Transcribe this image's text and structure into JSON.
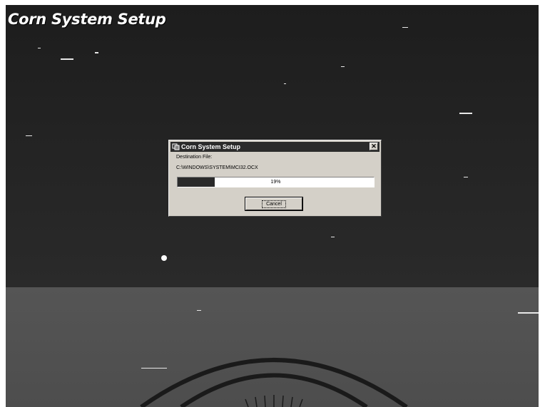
{
  "app_title": "Corn System Setup",
  "dialog": {
    "title": "Corn System Setup",
    "icon": "setup-icon",
    "close_glyph": "✕",
    "destination_label": "Destination File:",
    "destination_path": "C:\\WINDOWS\\SYSTEM\\MCI32.OCX",
    "progress_percent": 19,
    "progress_text": "19%",
    "cancel_label": "Cancel"
  },
  "colors": {
    "desktop_top": "#1d1d1d",
    "desktop_bottom": "#555555",
    "dialog_face": "#d4d0c8",
    "titlebar": "#2b2b2b",
    "progress_fill": "#2a2a2a"
  }
}
